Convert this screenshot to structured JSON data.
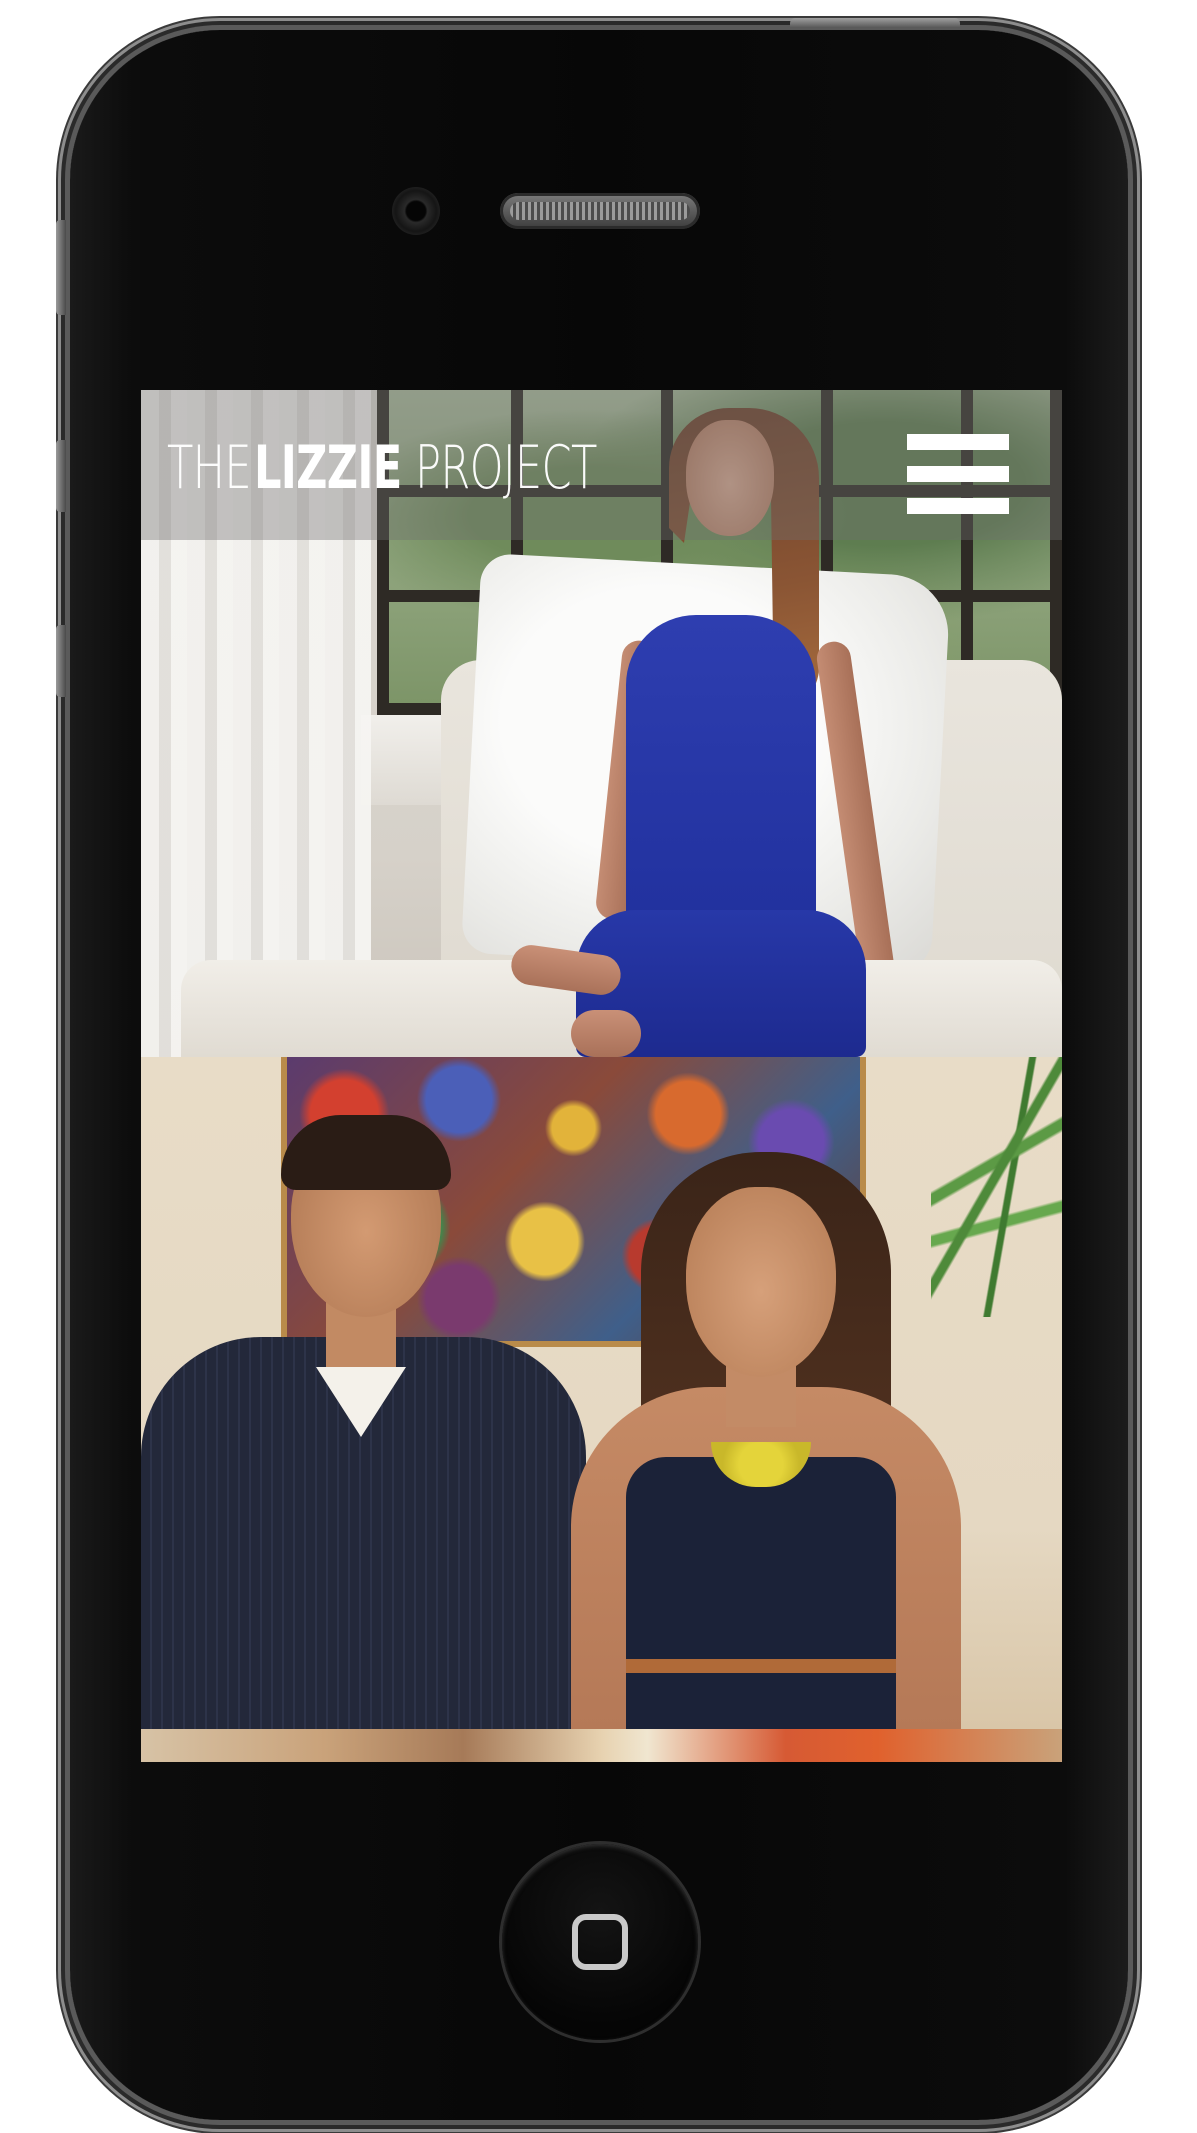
{
  "site": {
    "logo_prefix": "THE",
    "logo_name": "LIZZIE",
    "logo_suffix": "PROJECT"
  },
  "header": {
    "menu_icon": "hamburger-menu-icon"
  },
  "device": {
    "type": "smartphone",
    "home_button_icon": "home-square-icon"
  },
  "colors": {
    "header_overlay": "#6e6e6e",
    "logo_text": "#ffffff",
    "menu_icon": "#ffffff",
    "device_body": "#0a0a0a"
  }
}
